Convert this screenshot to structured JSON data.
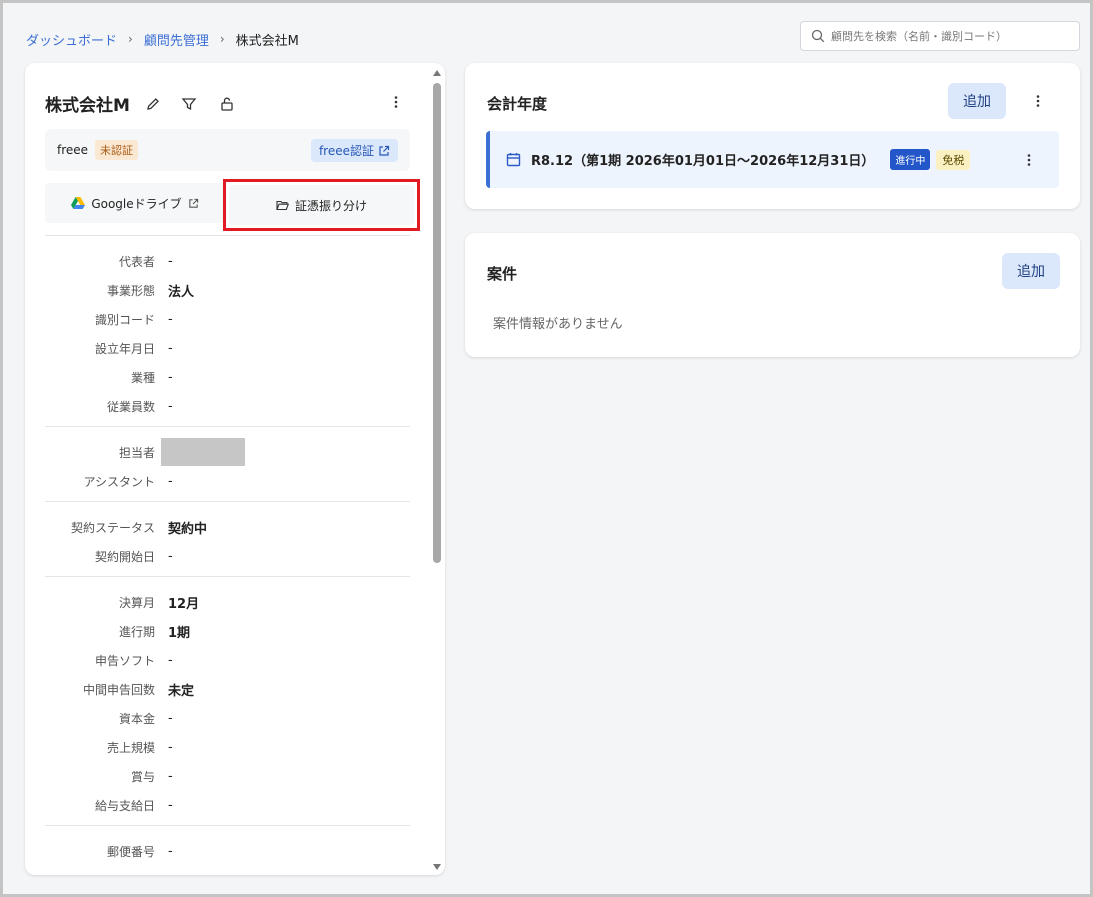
{
  "breadcrumb": {
    "items": [
      "ダッシュボード",
      "顧問先管理"
    ],
    "current": "株式会社M"
  },
  "search": {
    "placeholder": "顧問先を検索（名前・識別コード）"
  },
  "client": {
    "name": "株式会社M",
    "freee_label": "freee",
    "freee_status": "未認証",
    "freee_auth_label": "freee認証",
    "gdrive_label": "Googleドライブ",
    "voucher_label": "証憑振り分け"
  },
  "fields": {
    "representative": {
      "label": "代表者",
      "value": "-"
    },
    "business_type": {
      "label": "事業形態",
      "value": "法人"
    },
    "id_code": {
      "label": "識別コード",
      "value": "-"
    },
    "founded": {
      "label": "設立年月日",
      "value": "-"
    },
    "industry": {
      "label": "業種",
      "value": "-"
    },
    "employees": {
      "label": "従業員数",
      "value": "-"
    },
    "staff": {
      "label": "担当者"
    },
    "assistant": {
      "label": "アシスタント",
      "value": "-"
    },
    "contract_status": {
      "label": "契約ステータス",
      "value": "契約中"
    },
    "contract_start": {
      "label": "契約開始日",
      "value": "-"
    },
    "fiscal_month": {
      "label": "決算月",
      "value": "12月"
    },
    "current_period": {
      "label": "進行期",
      "value": "1期"
    },
    "tax_software": {
      "label": "申告ソフト",
      "value": "-"
    },
    "interim_count": {
      "label": "中間申告回数",
      "value": "未定"
    },
    "capital": {
      "label": "資本金",
      "value": "-"
    },
    "sales_scale": {
      "label": "売上規模",
      "value": "-"
    },
    "bonus": {
      "label": "賞与",
      "value": "-"
    },
    "payday": {
      "label": "給与支給日",
      "value": "-"
    },
    "postal_code": {
      "label": "郵便番号",
      "value": "-"
    }
  },
  "fiscal_year": {
    "title": "会計年度",
    "add_label": "追加",
    "item_text": "R8.12（第1期 2026年01月01日〜2026年12月31日）",
    "badge_active": "進行中",
    "badge_tax": "免税"
  },
  "cases": {
    "title": "案件",
    "add_label": "追加",
    "empty": "案件情報がありません"
  },
  "colors": {
    "link": "#3b6fd4",
    "primary": "#2357c9",
    "highlight_border": "#e01b24",
    "button_bg": "#dbe8fb"
  }
}
